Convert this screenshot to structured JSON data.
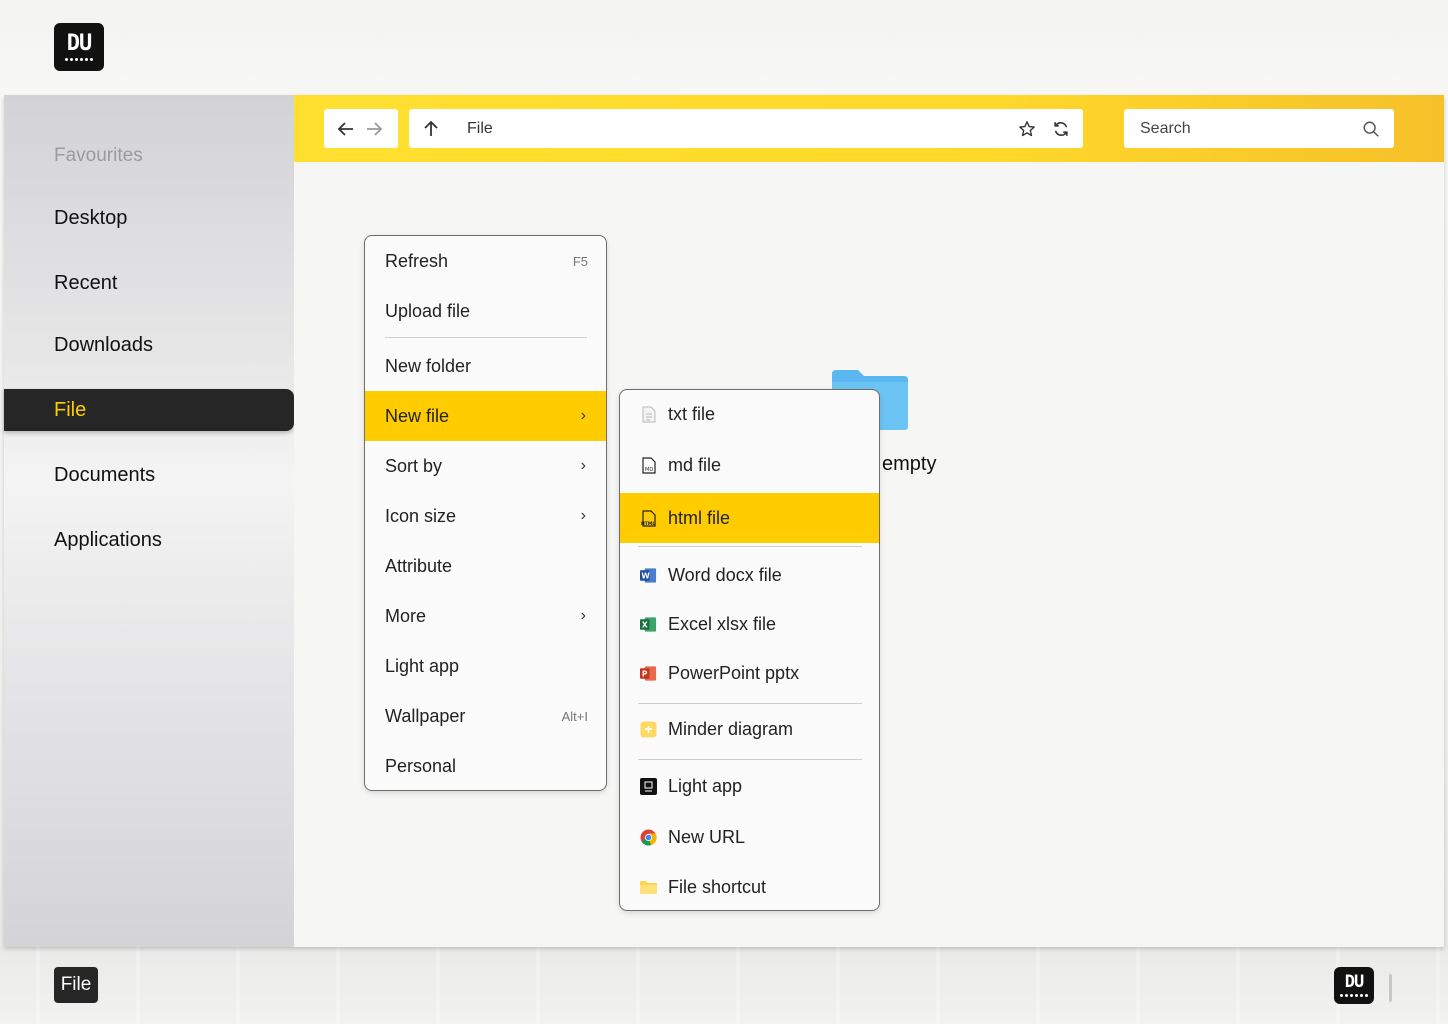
{
  "brand": {
    "logo_text": "DU"
  },
  "sidebar": {
    "header": "Favourites",
    "items": [
      {
        "label": "Desktop"
      },
      {
        "label": "Recent"
      },
      {
        "label": "Downloads"
      },
      {
        "label": "File",
        "active": true
      },
      {
        "label": "Documents"
      },
      {
        "label": "Applications"
      }
    ]
  },
  "toolbar": {
    "path": "File",
    "search_placeholder": "Search",
    "icons": [
      "back-arrow-icon",
      "forward-arrow-icon",
      "up-arrow-icon",
      "star-icon",
      "refresh-icon",
      "search-icon"
    ]
  },
  "folder": {
    "label": "empty",
    "color": "#5bb7ef"
  },
  "context_menu": {
    "items": [
      {
        "label": "Refresh",
        "shortcut": "F5"
      },
      {
        "label": "Upload file"
      },
      {
        "label": "New folder"
      },
      {
        "label": "New file",
        "submenu": true,
        "highlighted": true
      },
      {
        "label": "Sort by",
        "submenu": true
      },
      {
        "label": "Icon size",
        "submenu": true
      },
      {
        "label": "Attribute"
      },
      {
        "label": "More",
        "submenu": true
      },
      {
        "label": "Light app"
      },
      {
        "label": "Wallpaper",
        "shortcut": "Alt+I"
      },
      {
        "label": "Personal"
      }
    ]
  },
  "new_file_submenu": {
    "items": [
      {
        "label": "txt file",
        "icon": "txt-file-icon"
      },
      {
        "label": "md file",
        "icon": "md-file-icon"
      },
      {
        "label": "html file",
        "icon": "html-file-icon",
        "highlighted": true
      },
      {
        "label": "Word docx file",
        "icon": "word-icon"
      },
      {
        "label": "Excel xlsx file",
        "icon": "excel-icon"
      },
      {
        "label": "PowerPoint pptx",
        "icon": "powerpoint-icon"
      },
      {
        "label": "Minder diagram",
        "icon": "minder-icon"
      },
      {
        "label": "Light app",
        "icon": "light-app-icon"
      },
      {
        "label": "New URL",
        "icon": "chrome-icon"
      },
      {
        "label": "File shortcut",
        "icon": "folder-shortcut-icon"
      }
    ]
  },
  "taskbar": {
    "active_app": "File"
  },
  "colors": {
    "accent": "#ffcc00",
    "toolbar": "#ffdd2e",
    "dark": "#262626"
  }
}
